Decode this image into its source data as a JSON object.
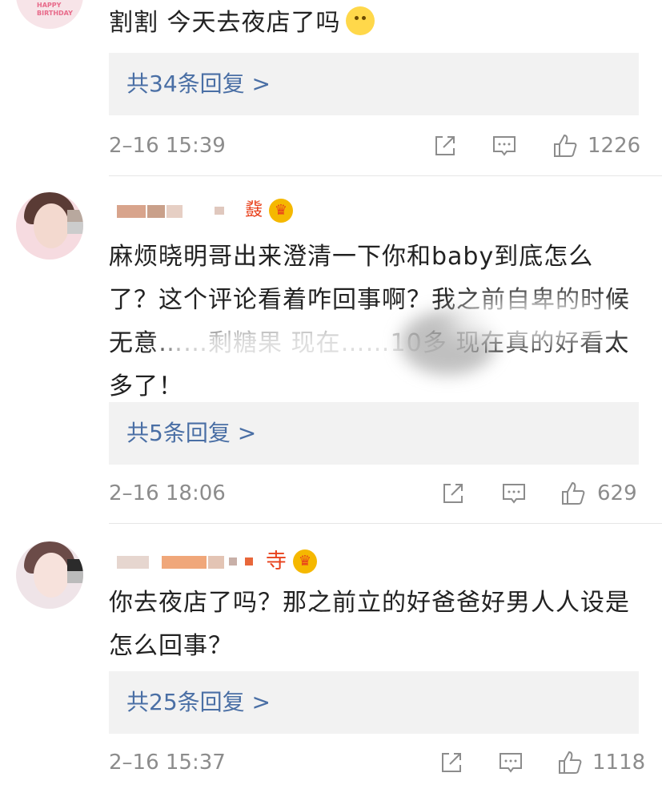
{
  "comments": [
    {
      "text": "割割 今天去夜店了吗",
      "reply_label": "共34条回复 >",
      "time": "2–16 15:39",
      "likes": "1226",
      "avatar_text": "HAPPY BIRTHDAY"
    },
    {
      "name_suffix": "鼗",
      "text": "麻烦晓明哥出来澄清一下你和baby到底怎么了？这个评论看着咋回事啊？我之前自卑的时候 无意……剩糖果 现在……10多 现在真的好看太多了！",
      "reply_label": "共5条回复 >",
      "time": "2–16 18:06",
      "likes": "629"
    },
    {
      "name_suffix": "寺",
      "text": "你去夜店了吗？那之前立的好爸爸好男人人设是怎么回事？",
      "reply_label": "共25条回复 >",
      "time": "2–16 15:37",
      "likes": "1118"
    }
  ],
  "icons": [
    "share-icon",
    "comment-icon",
    "like-icon",
    "crown-badge-icon",
    "blush-emoji"
  ],
  "colors": {
    "link": "#4a6fa5",
    "meta": "#8c8c8c",
    "reply_bg": "#f2f2f2",
    "accent": "#e8411c"
  }
}
